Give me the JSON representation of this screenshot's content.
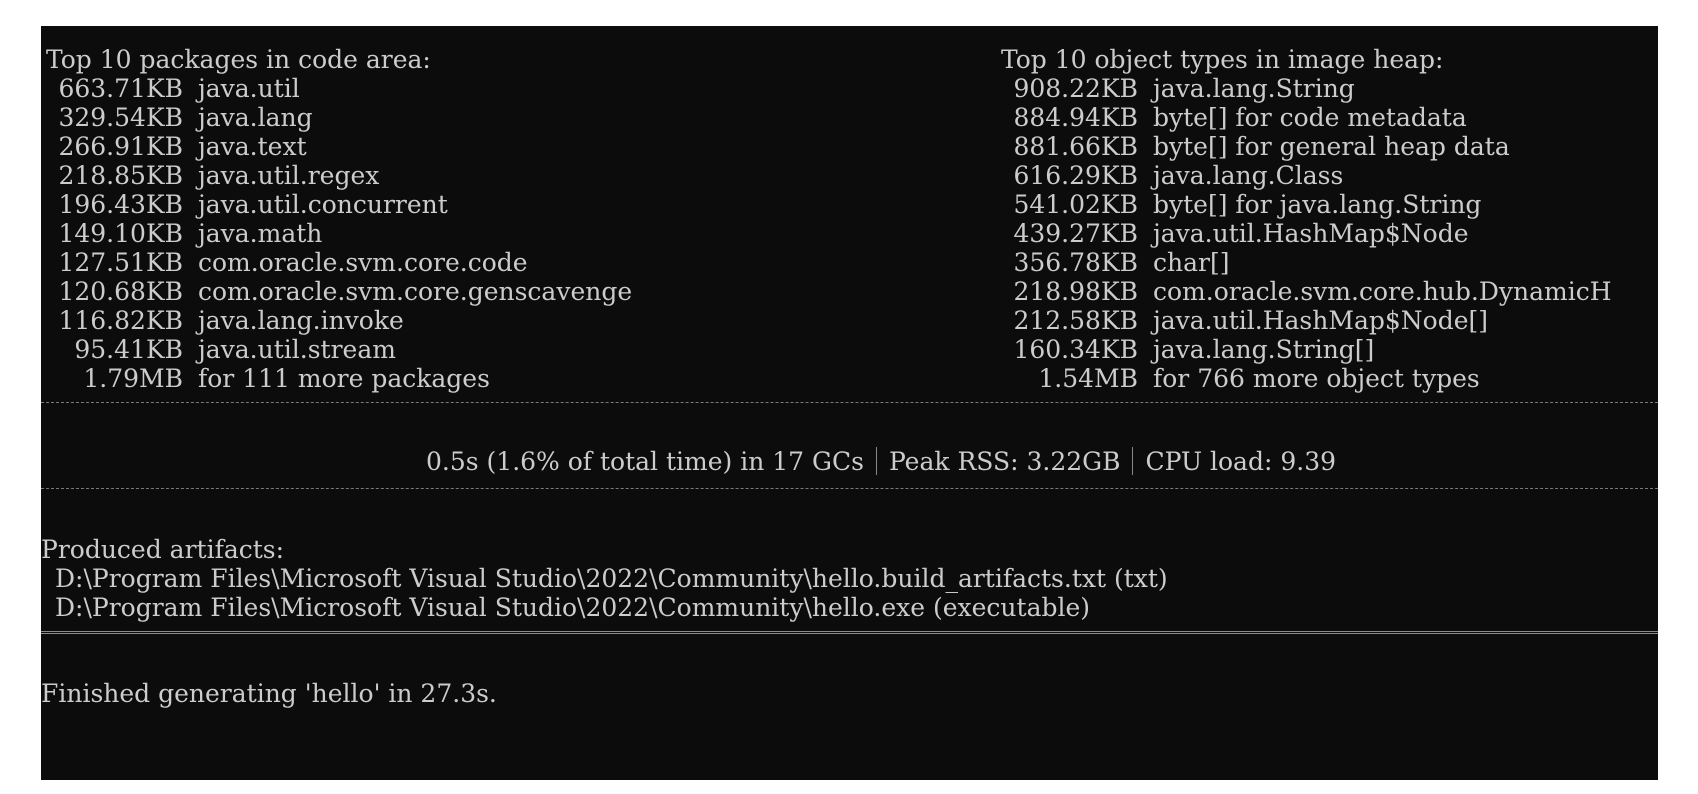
{
  "left": {
    "header": "Top 10 packages in code area:",
    "items": [
      {
        "size": "663.71KB",
        "label": "java.util"
      },
      {
        "size": "329.54KB",
        "label": "java.lang"
      },
      {
        "size": "266.91KB",
        "label": "java.text"
      },
      {
        "size": "218.85KB",
        "label": "java.util.regex"
      },
      {
        "size": "196.43KB",
        "label": "java.util.concurrent"
      },
      {
        "size": "149.10KB",
        "label": "java.math"
      },
      {
        "size": "127.51KB",
        "label": "com.oracle.svm.core.code"
      },
      {
        "size": "120.68KB",
        "label": "com.oracle.svm.core.genscavenge"
      },
      {
        "size": "116.82KB",
        "label": "java.lang.invoke"
      },
      {
        "size": "95.41KB",
        "label": "java.util.stream"
      }
    ],
    "more": {
      "size": "1.79MB",
      "label": "for 111 more packages"
    }
  },
  "right": {
    "header": "Top 10 object types in image heap:",
    "items": [
      {
        "size": "908.22KB",
        "label": "java.lang.String"
      },
      {
        "size": "884.94KB",
        "label": "byte[] for code metadata"
      },
      {
        "size": "881.66KB",
        "label": "byte[] for general heap data"
      },
      {
        "size": "616.29KB",
        "label": "java.lang.Class"
      },
      {
        "size": "541.02KB",
        "label": "byte[] for java.lang.String"
      },
      {
        "size": "439.27KB",
        "label": "java.util.HashMap$Node"
      },
      {
        "size": "356.78KB",
        "label": "char[]"
      },
      {
        "size": "218.98KB",
        "label": "com.oracle.svm.core.hub.DynamicH"
      },
      {
        "size": "212.58KB",
        "label": "java.util.HashMap$Node[]"
      },
      {
        "size": "160.34KB",
        "label": "java.lang.String[]"
      }
    ],
    "more": {
      "size": "1.54MB",
      "label": "for 766 more object types"
    }
  },
  "stats": {
    "gc": "0.5s (1.6% of total time) in 17 GCs",
    "rss": "Peak RSS: 3.22GB",
    "cpu": "CPU load: 9.39"
  },
  "artifacts": {
    "header": "Produced artifacts:",
    "items": [
      "D:\\Program Files\\Microsoft Visual Studio\\2022\\Community\\hello.build_artifacts.txt (txt)",
      "D:\\Program Files\\Microsoft Visual Studio\\2022\\Community\\hello.exe (executable)"
    ]
  },
  "finished": "Finished generating 'hello' in 27.3s.",
  "colors": {
    "background": "#0c0c0c",
    "text": "#cccccc"
  }
}
